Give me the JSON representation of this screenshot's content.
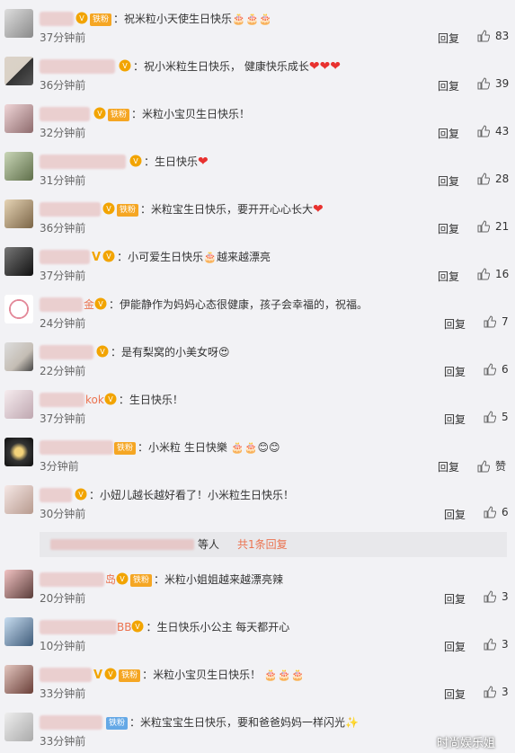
{
  "comments": [
    {
      "fan": "铁粉",
      "text": "祝米粒小天使生日快乐🎂🎂🎂",
      "time": "37分钟前",
      "reply": "回复",
      "likes": "83"
    },
    {
      "fan": "",
      "text": "祝小米粒生日快乐， 健康快乐成长",
      "hearts": "❤❤❤",
      "time": "36分钟前",
      "reply": "回复",
      "likes": "39"
    },
    {
      "fan": "铁粉",
      "text": "米粒小宝贝生日快乐！",
      "time": "32分钟前",
      "reply": "回复",
      "likes": "43"
    },
    {
      "fan": "",
      "text": "生日快乐",
      "hearts": "❤",
      "time": "31分钟前",
      "reply": "回复",
      "likes": "28"
    },
    {
      "fan": "铁粉",
      "text": "米粒宝生日快乐，要开开心心长大",
      "hearts": "❤",
      "time": "36分钟前",
      "reply": "回复",
      "likes": "21"
    },
    {
      "fan": "",
      "text": "小可爱生日快乐🎂越来越漂亮",
      "time": "37分钟前",
      "reply": "回复",
      "likes": "16"
    },
    {
      "fan": "",
      "name_tail": "金",
      "text": "伊能静作为妈妈心态很健康，孩子会幸福的，祝福。",
      "time": "24分钟前",
      "reply": "回复",
      "likes": "7"
    },
    {
      "fan": "",
      "text": "是有梨窝的小美女呀😍",
      "time": "22分钟前",
      "reply": "回复",
      "likes": "6"
    },
    {
      "fan": "",
      "name_tail": "kok",
      "text": "生日快乐！",
      "time": "37分钟前",
      "reply": "回复",
      "likes": "5"
    },
    {
      "fan": "铁粉",
      "text": "小米粒  生日快樂 🎂🎂😊😊",
      "time": "3分钟前",
      "reply": "回复",
      "likes": "赞"
    },
    {
      "fan": "",
      "text": "小妞儿越长越好看了！小米粒生日快乐！",
      "time": "30分钟前",
      "reply": "回复",
      "likes": "6"
    },
    {
      "fan": "铁粉",
      "name_tail": "岛",
      "text": "米粒小姐姐越来越漂亮辣",
      "time": "20分钟前",
      "reply": "回复",
      "likes": "3"
    },
    {
      "fan": "",
      "name_tail": "BB",
      "text": "生日快乐小公主 每天都开心",
      "time": "10分钟前",
      "reply": "回复",
      "likes": "3"
    },
    {
      "fan": "铁粉",
      "text": "米粒小宝贝生日快乐！ 🎂🎂🎂",
      "time": "33分钟前",
      "reply": "回复",
      "likes": "3"
    },
    {
      "fan": "铁粉",
      "text": "米粒宝宝生日快乐，要和爸爸妈妈一样闪光✨",
      "time": "33分钟前",
      "reply": "回复",
      "likes": ""
    }
  ],
  "sub_reply": {
    "people": "等人",
    "more": "共1条回复"
  },
  "watermark": "时尚娱乐姐",
  "colors": {
    "accent": "#eb7350",
    "fan_badge": "#f5a623",
    "heart": "#e8312f",
    "bg": "#f2f2f5"
  },
  "icons": {
    "vip": "vip-crown-icon",
    "like": "thumb-up-icon",
    "verified": "v-verified-icon"
  }
}
